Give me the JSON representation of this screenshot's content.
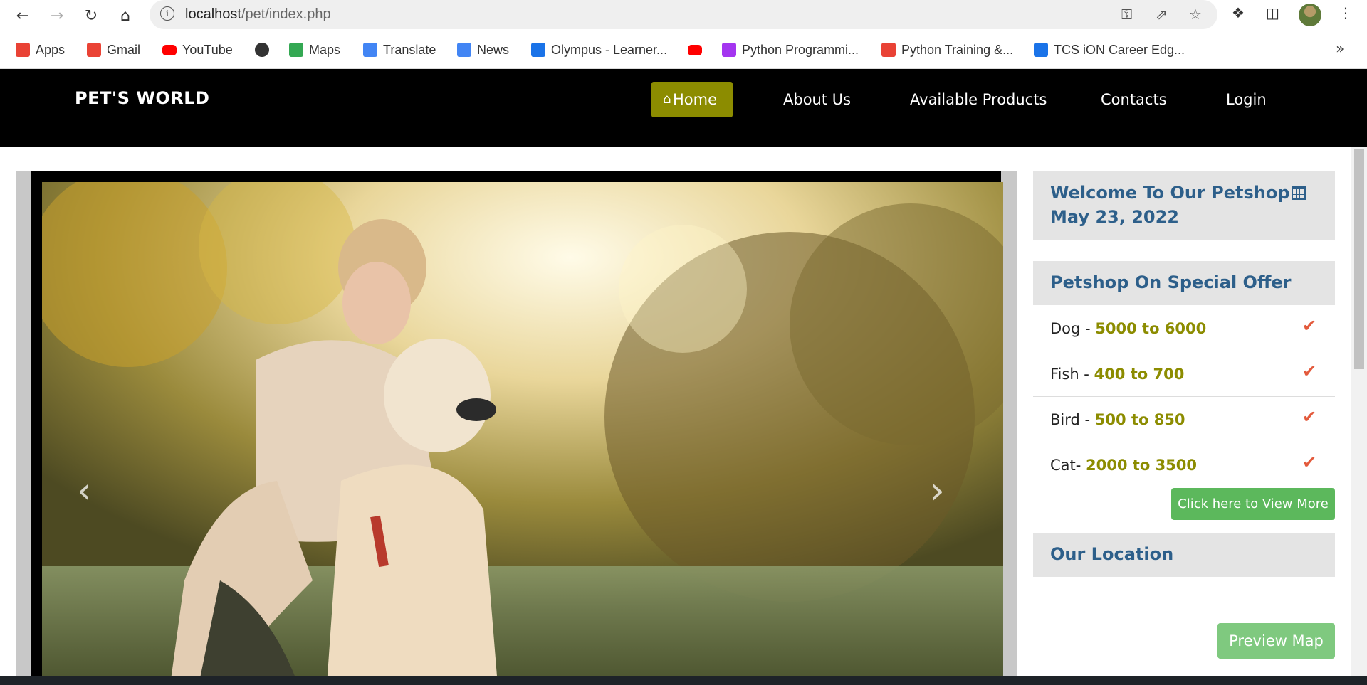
{
  "browser": {
    "url_host": "localhost",
    "url_path": "/pet/index.php",
    "bookmarks": [
      {
        "label": "Apps",
        "icon": "apps-grid-icon",
        "color": "#e94235"
      },
      {
        "label": "Gmail",
        "icon": "gmail-icon",
        "color": "#ea4335"
      },
      {
        "label": "YouTube",
        "icon": "youtube-icon",
        "color": "#ff0000"
      },
      {
        "label": "",
        "icon": "globe-icon",
        "color": "#333333"
      },
      {
        "label": "Maps",
        "icon": "maps-icon",
        "color": "#34a853"
      },
      {
        "label": "Translate",
        "icon": "translate-icon",
        "color": "#4285f4"
      },
      {
        "label": "News",
        "icon": "news-icon",
        "color": "#4285f4"
      },
      {
        "label": "Olympus - Learner...",
        "icon": "olympus-icon",
        "color": "#1a73e8"
      },
      {
        "label": "",
        "icon": "youtube-icon",
        "color": "#ff0000"
      },
      {
        "label": "Python Programmi...",
        "icon": "udemy-icon",
        "color": "#a435f0"
      },
      {
        "label": "Python Training &...",
        "icon": "training-icon",
        "color": "#e94235"
      },
      {
        "label": "TCS iON Career Edg...",
        "icon": "tcs-icon",
        "color": "#1a73e8"
      }
    ]
  },
  "site": {
    "brand": "PET'S WORLD",
    "menu": [
      "Home",
      "About Us",
      "Available Products",
      "Contacts",
      "Login"
    ],
    "accent_color": "#8c8c00"
  },
  "sidebar": {
    "welcome_title": "Welcome To Our Petshop",
    "welcome_date": "May 23, 2022",
    "offer_title": "Petshop On Special Offer",
    "offers": [
      {
        "animal": "Dog - ",
        "price": "5000 to 6000"
      },
      {
        "animal": "Fish - ",
        "price": "400 to 700"
      },
      {
        "animal": "Bird - ",
        "price": "500 to 850"
      },
      {
        "animal": "Cat- ",
        "price": "2000 to 3500"
      }
    ],
    "view_more_label": "Click here to View More",
    "location_title": "Our Location",
    "preview_map_label": "Preview Map"
  }
}
